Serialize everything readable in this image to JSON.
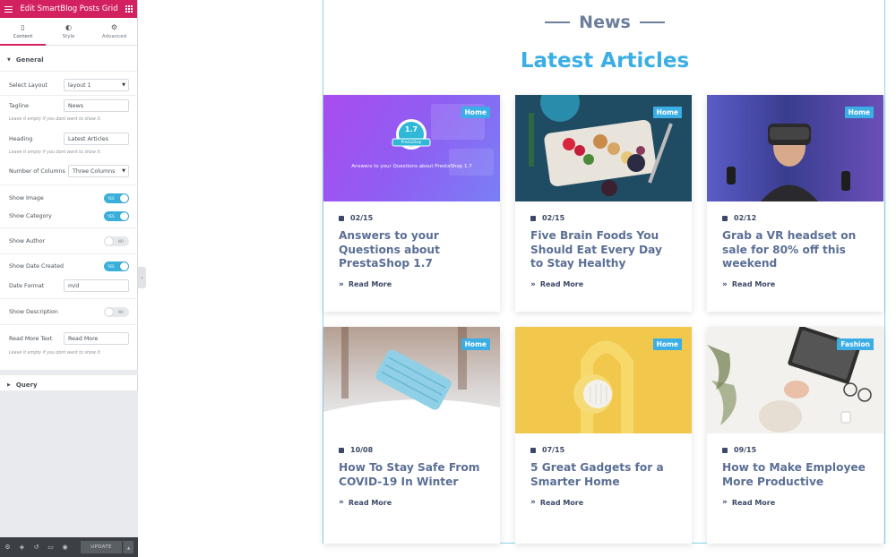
{
  "panel": {
    "title": "Edit SmartBlog Posts Grid",
    "tabs": [
      {
        "label": "Content",
        "icon": "columns-icon",
        "glyph": "▯"
      },
      {
        "label": "Style",
        "icon": "contrast-icon",
        "glyph": "◐"
      },
      {
        "label": "Advanced",
        "icon": "gear-icon",
        "glyph": "⚙"
      }
    ],
    "general_label": "General",
    "select_layout": {
      "label": "Select Layout",
      "value": "layout 1"
    },
    "tagline": {
      "label": "Tagline",
      "value": "News",
      "hint": "Leave it empty if you dont want to show it."
    },
    "heading": {
      "label": "Heading",
      "value": "Latest Articles",
      "hint": "Leave it empty if you dont want to show it."
    },
    "columns": {
      "label": "Number of Columns",
      "value": "Three Columns"
    },
    "show_image": {
      "label": "Show Image",
      "state": "YES"
    },
    "show_category": {
      "label": "Show Category",
      "state": "YES"
    },
    "show_author": {
      "label": "Show Author",
      "state": "NO"
    },
    "show_date": {
      "label": "Show Date Created",
      "state": "YES"
    },
    "date_format": {
      "label": "Date Format",
      "value": "m/d"
    },
    "show_description": {
      "label": "Show Description",
      "state": "NO"
    },
    "read_more": {
      "label": "Read More Text",
      "value": "Read More",
      "hint": "Leave it empty if you dont want to show it."
    },
    "query_label": "Query",
    "update_label": "UPDATE"
  },
  "preview": {
    "tagline": "News",
    "heading": "Latest Articles",
    "image_caption": {
      "version": "1.7",
      "brand": "PrestaShop",
      "text": "Answers to your Questions about PrestaShop 1.7"
    },
    "cards": [
      {
        "category": "Home",
        "date": "02/15",
        "title": "Answers to your Questions about PrestaShop 1.7",
        "read_more": "Read More"
      },
      {
        "category": "Home",
        "date": "02/15",
        "title": "Five Brain Foods You Should Eat Every Day to Stay Healthy",
        "read_more": "Read More"
      },
      {
        "category": "Home",
        "date": "02/12",
        "title": "Grab a VR headset on sale for 80% off this weekend",
        "read_more": "Read More"
      },
      {
        "category": "Home",
        "date": "10/08",
        "title": "How To Stay Safe From COVID-19 In Winter",
        "read_more": "Read More"
      },
      {
        "category": "Home",
        "date": "07/15",
        "title": "5 Great Gadgets for a Smarter Home",
        "read_more": "Read More"
      },
      {
        "category": "Fashion",
        "date": "09/15",
        "title": "How to Make Employee More Productive",
        "read_more": "Read More"
      }
    ]
  },
  "colors": {
    "accent": "#d3215f",
    "brand_blue": "#3aaee5",
    "title_gray": "#5b6f95",
    "toggle_on": "#39b0d9"
  }
}
